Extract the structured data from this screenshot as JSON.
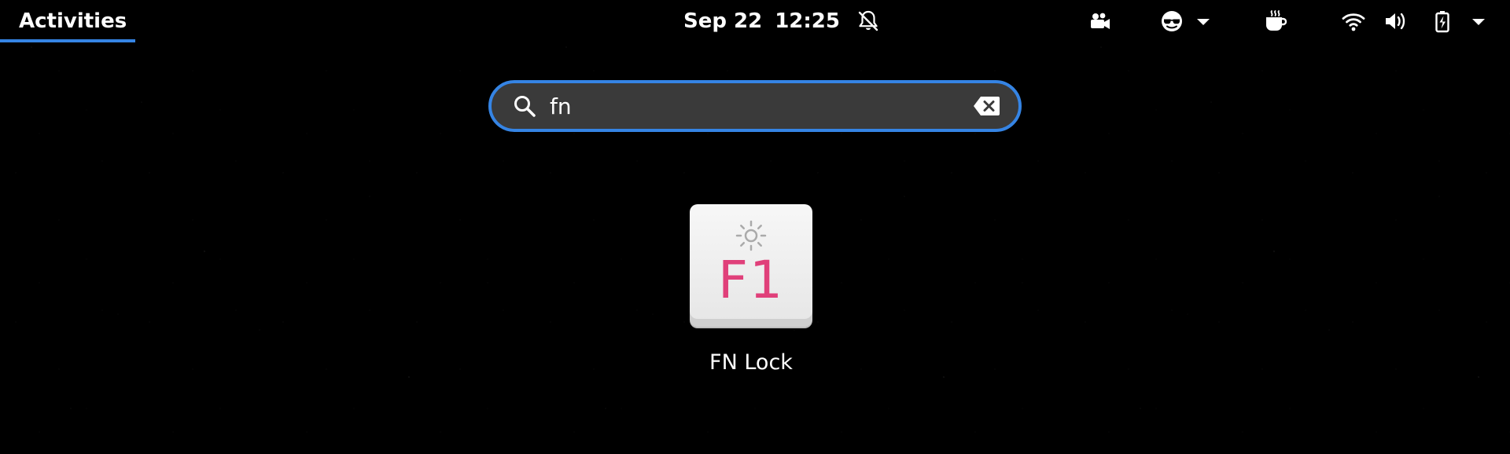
{
  "topbar": {
    "activities_label": "Activities",
    "date": "Sep 22",
    "time": "12:25",
    "icons": [
      "notifications-disabled-icon",
      "camera-icon",
      "screen-share-icon",
      "chevron-down-icon",
      "caffeine-icon",
      "wifi-icon",
      "volume-icon",
      "battery-icon",
      "chevron-down-icon"
    ]
  },
  "search": {
    "value": "fn",
    "placeholder": ""
  },
  "results": [
    {
      "name": "FN Lock",
      "icon": "fn-lock-icon",
      "key_label": "F1"
    }
  ],
  "colors": {
    "accent": "#3584e4",
    "search_bg": "#3a3a3a",
    "key_text": "#e0407a"
  }
}
